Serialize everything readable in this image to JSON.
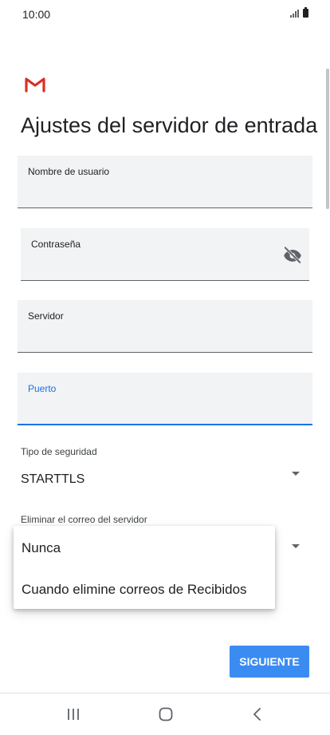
{
  "status_bar": {
    "time": "10:00"
  },
  "page": {
    "title": "Ajustes del servidor de entrada"
  },
  "fields": {
    "username": {
      "label": "Nombre de usuario",
      "value": ""
    },
    "password": {
      "label": "Contraseña",
      "value": ""
    },
    "server": {
      "label": "Servidor",
      "value": ""
    },
    "port": {
      "label": "Puerto",
      "value": ""
    }
  },
  "security_type": {
    "label": "Tipo de seguridad",
    "value": "STARTTLS"
  },
  "delete_from_server": {
    "label": "Eliminar el correo del servidor",
    "options": [
      "Nunca",
      "Cuando elimine correos de Recibidos"
    ]
  },
  "actions": {
    "next_label": "SIGUIENTE"
  },
  "icons": {
    "app_logo": "gmail-logo",
    "password_toggle": "eye-off-icon",
    "dropdown": "chevron-down-icon",
    "nav_recents": "recents-icon",
    "nav_home": "home-icon",
    "nav_back": "back-icon"
  },
  "colors": {
    "accent": "#1a73e8",
    "button": "#3b8cf2",
    "field_bg": "#f1f3f4",
    "gmail_red": "#d93025"
  }
}
